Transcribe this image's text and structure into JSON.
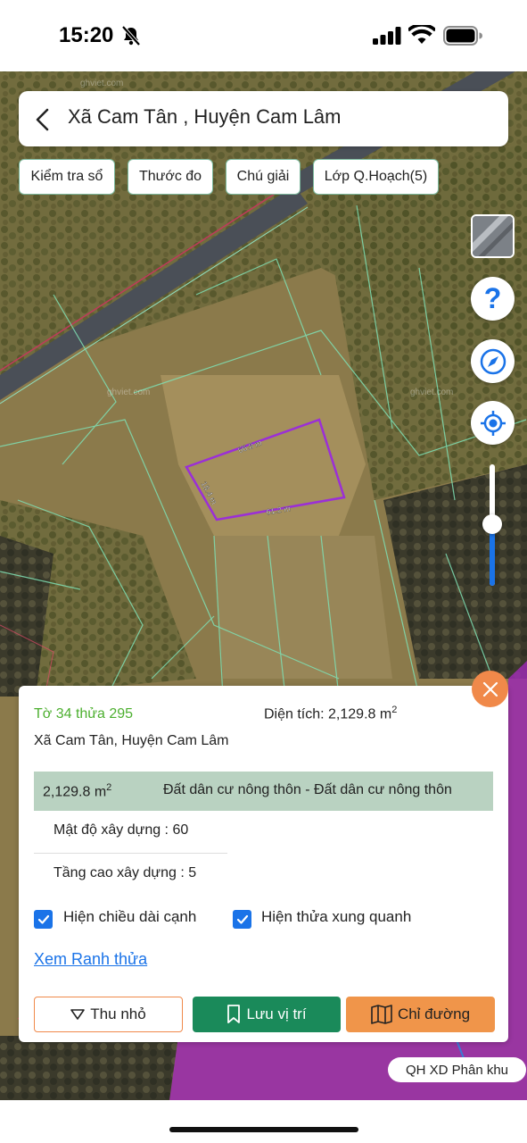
{
  "status_bar": {
    "time": "15:20"
  },
  "header": {
    "title": "Xã Cam Tân , Huyện Cam Lâm"
  },
  "chips": [
    "Kiểm tra sổ",
    "Thước đo",
    "Chú giải",
    "Lớp Q.Hoạch(5)"
  ],
  "tools": {
    "help_label": "?"
  },
  "map": {
    "edge_labels": [
      "66.8 m",
      "18.4 m",
      "61.2 m"
    ],
    "watermark": "ghviet.com",
    "zoom_level": 0.5
  },
  "panel": {
    "parcel_id": "Tờ 34 thửa 295",
    "area_prefix": "Diện tích: 2,129.8 m",
    "area_sup": "2",
    "address": "Xã Cam Tân, Huyện Cam Lâm",
    "zone_area": "2,129.8 m",
    "zone_area_sup": "2",
    "zone_type": "Đất dân cư nông thôn - Đất dân cư nông thôn",
    "density": "Mật độ xây dựng : 60",
    "height": "Tầng cao xây dựng : 5",
    "checkbox_edges": "Hiện chiều dài cạnh",
    "checkbox_neighbors": "Hiện thửa xung quanh",
    "link_boundary": "Xem Ranh thửa",
    "btn_shrink": "Thu nhỏ",
    "btn_save": "Lưu vị trí",
    "btn_route": "Chỉ đường"
  },
  "plan_badge": "QH XD Phân khu",
  "colors": {
    "accent_green": "#4caf2f",
    "save_green": "#1a8a5a",
    "orange": "#f0894a",
    "blue": "#1a73e8",
    "parcel_outline": "#9b2fd6"
  }
}
